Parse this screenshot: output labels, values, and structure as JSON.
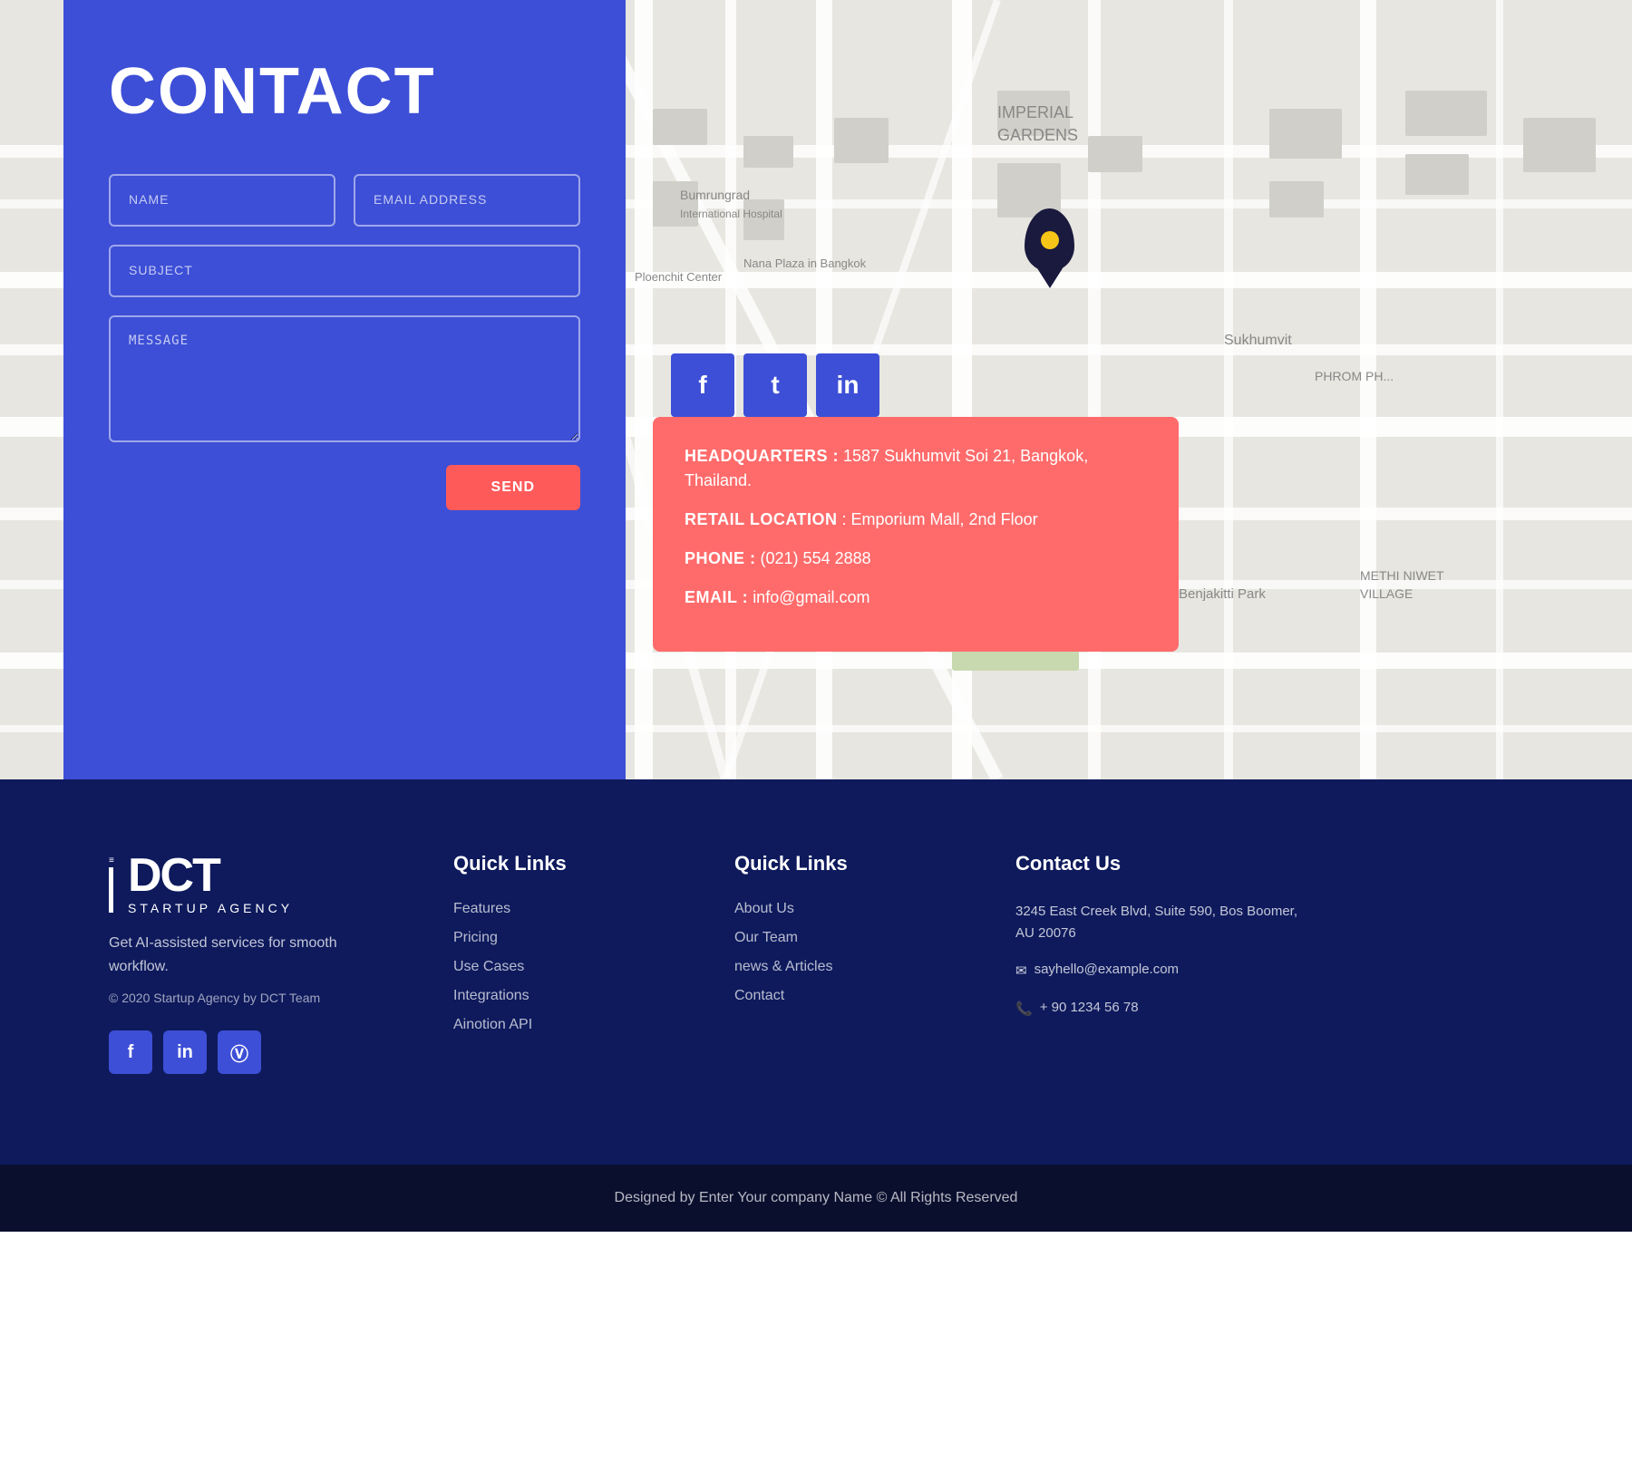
{
  "header": {
    "title": "CONTACT"
  },
  "form": {
    "name_placeholder": "NAME",
    "email_placeholder": "EMAIL ADDRESS",
    "subject_placeholder": "SUBJECT",
    "message_placeholder": "MESSAGE",
    "submit_label": "SEND"
  },
  "social": {
    "facebook": "f",
    "twitter": "t",
    "linkedin": "in"
  },
  "info_card": {
    "headquarters_label": "HEADQUARTERS :",
    "headquarters_value": " 1587 Sukhumvit Soi 21, Bangkok, Thailand.",
    "retail_label": "RETAIL LOCATION",
    "retail_value": " : Emporium Mall, 2nd Floor",
    "phone_label": "PHONE :",
    "phone_value": " (021) 554 2888",
    "email_label": "EMAIL :",
    "email_value": " info@gmail.com"
  },
  "footer": {
    "logo": {
      "brand": "DCT",
      "subtitle": "STARTUP AGENCY",
      "tagline": "Get AI-assisted services for smooth workflow.",
      "copyright": "© 2020 Startup Agency by DCT Team"
    },
    "quick_links_1": {
      "title": "Quick Links",
      "links": [
        "Features",
        "Pricing",
        "Use Cases",
        "Integrations",
        "Ainotion API"
      ]
    },
    "quick_links_2": {
      "title": "Quick Links",
      "links": [
        "About Us",
        "Our Team",
        "news & Articles",
        "Contact"
      ]
    },
    "contact_us": {
      "title": "Contact Us",
      "address": "3245 East Creek Blvd, Suite 590, Bos Boomer, AU 20076",
      "email": "sayhello@example.com",
      "phone": "+ 90 1234 56 78"
    }
  },
  "bottom_bar": {
    "text": "Designed by Enter Your company Name © All Rights Reserved"
  }
}
